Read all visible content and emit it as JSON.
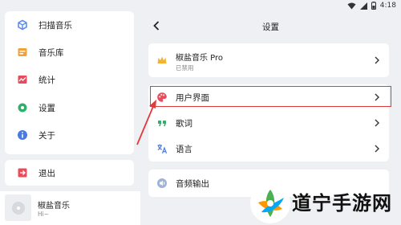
{
  "status_bar": {
    "time": "4:18"
  },
  "sidebar": {
    "items": [
      {
        "label": "扫描音乐",
        "icon": "scan-icon"
      },
      {
        "label": "音乐库",
        "icon": "library-icon"
      },
      {
        "label": "统计",
        "icon": "stats-icon"
      },
      {
        "label": "设置",
        "icon": "gear-icon"
      },
      {
        "label": "关于",
        "icon": "info-icon"
      }
    ],
    "exit": {
      "label": "退出",
      "icon": "exit-icon"
    }
  },
  "player": {
    "title": "椒盐音乐",
    "subtitle": "Hi~"
  },
  "settings": {
    "title": "设置",
    "pro": {
      "title": "椒盐音乐 Pro",
      "status": "已禁用",
      "icon": "crown-icon"
    },
    "items": [
      {
        "label": "用户界面",
        "icon": "palette-icon"
      },
      {
        "label": "歌词",
        "icon": "quote-icon"
      },
      {
        "label": "语言",
        "icon": "translate-icon"
      }
    ],
    "audio": {
      "label": "音频输出",
      "icon": "speaker-icon"
    }
  },
  "watermark": {
    "text": "道宁手游网"
  },
  "colors": {
    "accent": "#5b8def",
    "highlight": "#e23a3a",
    "crown": "#f2b233"
  }
}
